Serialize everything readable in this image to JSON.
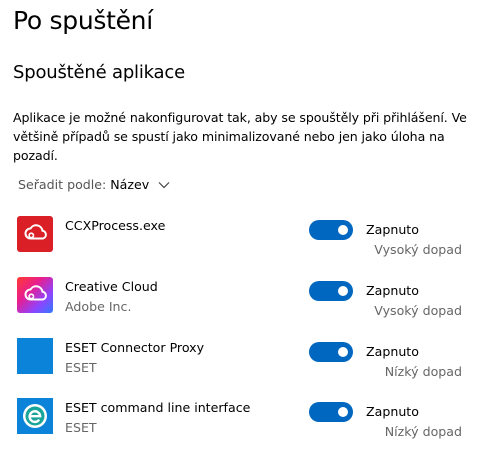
{
  "page": {
    "title": "Po spuštění"
  },
  "section": {
    "title": "Spouštěné aplikace",
    "description": "Aplikace je možné nakonfigurovat tak, aby se spouštěly při přihlášení. Ve většině případů se spustí jako minimalizované nebo jen jako úloha na pozadí."
  },
  "sort": {
    "label": "Seřadit podle:",
    "value": "Název",
    "icon": "chevron-down-icon"
  },
  "colors": {
    "accent": "#0067c0",
    "eset_blue": "#0a83d8",
    "adobe_red": "#da1f26"
  },
  "apps": [
    {
      "name": "CCXProcess.exe",
      "publisher": "",
      "icon": "adobe-cc-red-icon",
      "state": "Zapnuto",
      "enabled": true,
      "impact": "Vysoký dopad"
    },
    {
      "name": "Creative Cloud",
      "publisher": "Adobe Inc.",
      "icon": "creative-cloud-icon",
      "state": "Zapnuto",
      "enabled": true,
      "impact": "Vysoký dopad"
    },
    {
      "name": "ESET Connector Proxy",
      "publisher": "ESET",
      "icon": "eset-blank-icon",
      "state": "Zapnuto",
      "enabled": true,
      "impact": "Nízký dopad"
    },
    {
      "name": "ESET command line interface",
      "publisher": "ESET",
      "icon": "eset-e-icon",
      "state": "Zapnuto",
      "enabled": true,
      "impact": "Nízký dopad"
    }
  ]
}
